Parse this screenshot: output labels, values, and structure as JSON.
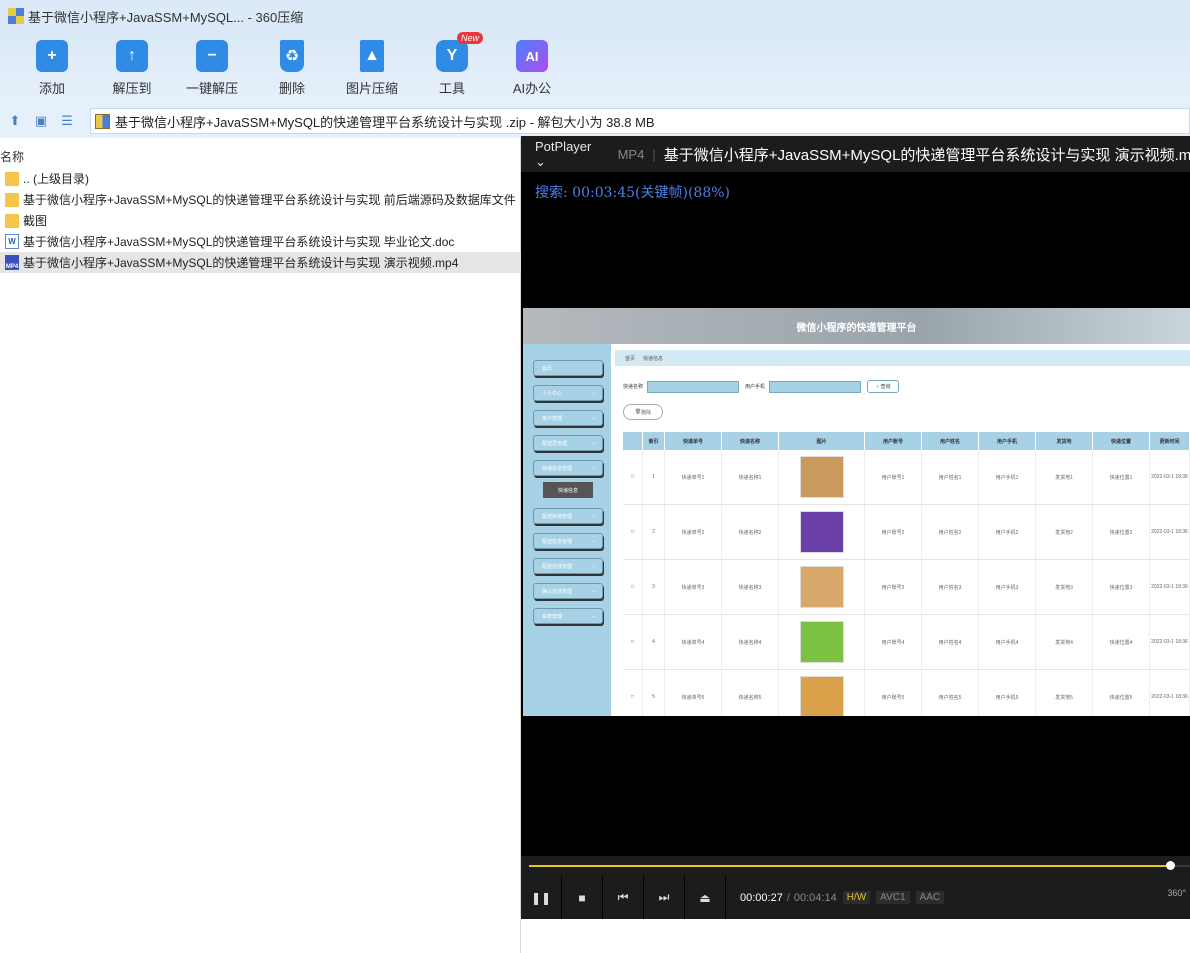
{
  "window": {
    "title": "基于微信小程序+JavaSSM+MySQL... - 360压缩"
  },
  "toolbar": {
    "items": [
      {
        "label": "添加",
        "color": "#2f8be6"
      },
      {
        "label": "解压到",
        "color": "#2f8be6"
      },
      {
        "label": "一键解压",
        "color": "#2f8be6"
      },
      {
        "label": "删除",
        "color": "#2f8be6"
      },
      {
        "label": "图片压缩",
        "color": "#2f8be6"
      },
      {
        "label": "工具",
        "color": "#2f8be6",
        "badge": "New"
      },
      {
        "label": "AI办公",
        "color": "#8a5cf0",
        "glyph": "AI"
      }
    ]
  },
  "address": {
    "text": "基于微信小程序+JavaSSM+MySQL的快递管理平台系统设计与实现 .zip - 解包大小为 38.8 MB"
  },
  "list": {
    "header": "名称",
    "rows": [
      {
        "name": ".. (上级目录)",
        "type": "folder"
      },
      {
        "name": "基于微信小程序+JavaSSM+MySQL的快递管理平台系统设计与实现 前后端源码及数据库文件",
        "type": "folder"
      },
      {
        "name": "截图",
        "type": "folder"
      },
      {
        "name": "基于微信小程序+JavaSSM+MySQL的快递管理平台系统设计与实现 毕业论文.doc",
        "type": "doc"
      },
      {
        "name": "基于微信小程序+JavaSSM+MySQL的快递管理平台系统设计与实现 演示视频.mp4",
        "type": "mp4",
        "selected": true
      }
    ]
  },
  "player": {
    "brand": "PotPlayer",
    "format": "MP4",
    "title": "基于微信小程序+JavaSSM+MySQL的快递管理平台系统设计与实现 演示视频.mp4",
    "seek_message": "搜索: 00:03:45(关键帧)(88%)",
    "time_current": "00:00:27",
    "time_total": "00:04:14",
    "tags": [
      "H/W",
      "AVC1",
      "AAC"
    ],
    "progress": 0.97,
    "vr_label": "360°"
  },
  "video_frame": {
    "header": "微信小程序的快递管理平台",
    "menu": [
      "首页",
      "个人中心",
      "用户管理",
      "配送员管理",
      "快递信息管理",
      "配送快递管理",
      "配送信息管理",
      "配送完成管理",
      "确认完成管理",
      "系统管理"
    ],
    "submenu": "快递信息",
    "breadcrumb": [
      "首页",
      "快递信息"
    ],
    "search_label_1": "快递名称",
    "search_label_2": "用户手机",
    "search_button": "查询",
    "delete_button": "删除",
    "columns": [
      "",
      "索引",
      "快递单号",
      "快递名称",
      "图片",
      "用户账号",
      "用户姓名",
      "用户手机",
      "发货地",
      "快递位置",
      "更新时间"
    ],
    "rows": [
      [
        "1",
        "快递单号1",
        "快递名称1",
        "用户账号1",
        "用户姓名1",
        "用户手机1",
        "发货地1",
        "快递位置1",
        "2022-03-1 18:36"
      ],
      [
        "2",
        "快递单号2",
        "快递名称2",
        "用户账号2",
        "用户姓名2",
        "用户手机2",
        "发货地2",
        "快递位置2",
        "2022-03-1 18:36"
      ],
      [
        "3",
        "快递单号3",
        "快递名称3",
        "用户账号3",
        "用户姓名3",
        "用户手机3",
        "发货地3",
        "快递位置3",
        "2022-03-1 18:36"
      ],
      [
        "4",
        "快递单号4",
        "快递名称4",
        "用户账号4",
        "用户姓名4",
        "用户手机4",
        "发货地4",
        "快递位置4",
        "2022-03-1 18:36"
      ],
      [
        "5",
        "快递单号5",
        "快递名称5",
        "用户账号5",
        "用户姓名5",
        "用户手机5",
        "发货地5",
        "快递位置5",
        "2022-03-1 18:36"
      ]
    ]
  }
}
